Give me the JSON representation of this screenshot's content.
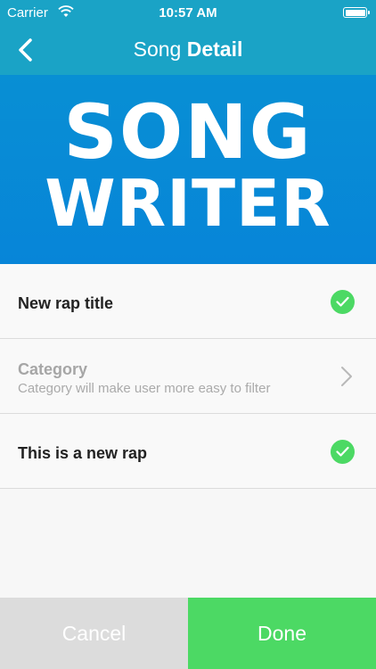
{
  "status_bar": {
    "carrier": "Carrier",
    "time": "10:57 AM"
  },
  "nav": {
    "title_light": "Song",
    "title_bold": "Detail"
  },
  "banner": {
    "line1": "SONG",
    "line2": "WRITER"
  },
  "list": {
    "title_row": {
      "label": "New rap title",
      "checked": true
    },
    "category_row": {
      "title": "Category",
      "subtitle": "Category will make user more easy to filter"
    },
    "lyrics_row": {
      "label": "This is a new rap",
      "checked": true
    }
  },
  "actions": {
    "cancel_label": "Cancel",
    "done_label": "Done"
  },
  "colors": {
    "nav_bg": "#1aa3c6",
    "banner_bg": "#0785d8",
    "success": "#4cd964",
    "cancel_bg": "#dcdcdc"
  },
  "icons": [
    "wifi-icon",
    "battery-icon",
    "back-chevron-icon",
    "check-circle-icon",
    "chevron-right-icon"
  ]
}
